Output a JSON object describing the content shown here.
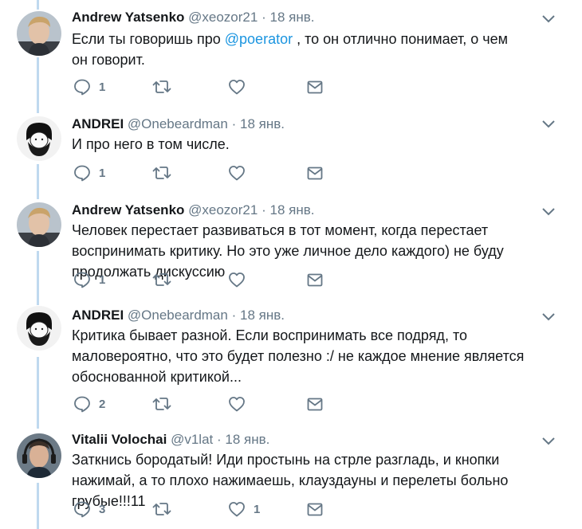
{
  "tweets": [
    {
      "name": "Andrew Yatsenko",
      "handle": "@xeozor21",
      "dot": "·",
      "time": "18 янв.",
      "text_before": "Если ты говоришь про ",
      "mention": "@poerator",
      "text_after": " , то он отлично понимает, о чем он говорит.",
      "reply_count": "1",
      "retweet_count": "",
      "like_count": "",
      "avatar": "photo-man-blond"
    },
    {
      "name": "ANDREI",
      "handle": "@Onebeardman",
      "dot": "·",
      "time": "18 янв.",
      "text": "И про него в том числе.",
      "reply_count": "1",
      "retweet_count": "",
      "like_count": "",
      "avatar": "sketch-bearded-man"
    },
    {
      "name": "Andrew Yatsenko",
      "handle": "@xeozor21",
      "dot": "·",
      "time": "18 янв.",
      "text": "Человек перестает развиваться в тот момент, когда перестает воспринимать критику. Но это уже личное дело каждого) не буду продолжать дискуссию",
      "reply_count": "1",
      "retweet_count": "",
      "like_count": "",
      "avatar": "photo-man-blond"
    },
    {
      "name": "ANDREI",
      "handle": "@Onebeardman",
      "dot": "·",
      "time": "18 янв.",
      "text": "Критика бывает разной. Если воспринимать все подряд, то маловероятно, что это будет полезно :/ не каждое мнение является обоснованной критикой...",
      "reply_count": "2",
      "retweet_count": "",
      "like_count": "",
      "avatar": "sketch-bearded-man"
    },
    {
      "name": "Vitalii Volochai",
      "handle": "@v1lat",
      "dot": "·",
      "time": "18 янв.",
      "text": "Заткнись бородатый! Иди простынь на стрле разгладь, и кнопки нажимай, а то плохо нажимаешь, клауздауны и перелеты больно грубые!!!11",
      "reply_count": "3",
      "retweet_count": "",
      "like_count": "1",
      "avatar": "photo-man-headset"
    }
  ],
  "colors": {
    "name": "#14171a",
    "meta": "#657786",
    "mention": "#1b95e0",
    "thread_line": "#bfd9ef",
    "icon": "#657786"
  }
}
